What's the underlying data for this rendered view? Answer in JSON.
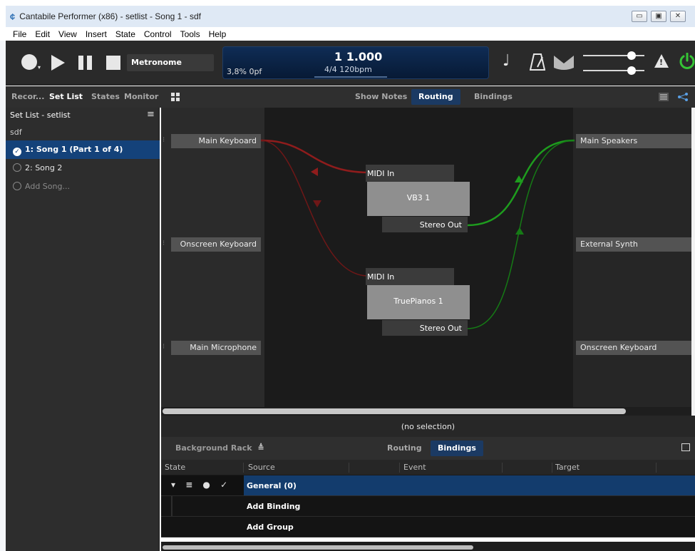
{
  "window": {
    "title": "Cantabile Performer (x86) - setlist - Song 1 - sdf",
    "app_icon": "¢",
    "controls": [
      "▭",
      "▣",
      "✕"
    ]
  },
  "menu": [
    "File",
    "Edit",
    "View",
    "Insert",
    "State",
    "Control",
    "Tools",
    "Help"
  ],
  "transport": {
    "metronome_label": "Metronome",
    "cpu": "3,8% 0pf",
    "position": "1 1.000",
    "tempo": "4/4 120bpm",
    "record_arrow": "▾"
  },
  "left_tabs": [
    {
      "label": "Recor...",
      "active": false
    },
    {
      "label": "Set List",
      "active": true
    },
    {
      "label": "States",
      "active": false
    },
    {
      "label": "Monitor",
      "active": false
    }
  ],
  "center_tabs": [
    {
      "label": "Show Notes",
      "active": false
    },
    {
      "label": "Routing",
      "active": true
    },
    {
      "label": "Bindings",
      "active": false
    }
  ],
  "setlist": {
    "header": "Set List - setlist",
    "name": "sdf",
    "songs": [
      {
        "label": "1: Song 1 (Part 1 of 4)",
        "active": true
      },
      {
        "label": "2: Song 2",
        "active": false
      },
      {
        "label": "Add Song...",
        "active": false
      }
    ]
  },
  "routing": {
    "inputs": [
      "Main Keyboard",
      "Onscreen Keyboard",
      "Main Microphone"
    ],
    "outputs": [
      "Main Speakers",
      "External Synth",
      "Onscreen Keyboard"
    ],
    "plugins": [
      {
        "name": "VB3 1",
        "in": "MIDI In",
        "out": "Stereo Out"
      },
      {
        "name": "TruePianos 1",
        "in": "MIDI In",
        "out": "Stereo Out"
      }
    ],
    "colors": {
      "midi": "#8f1c1c",
      "audio": "#1e9c1e"
    }
  },
  "status": "(no selection)",
  "bottom": {
    "rack_label": "Background Rack",
    "rack_icon": "≜",
    "tabs": [
      {
        "label": "Routing",
        "active": false
      },
      {
        "label": "Bindings",
        "active": true
      }
    ],
    "columns": [
      "State",
      "Source",
      "Event",
      "Target"
    ],
    "group_label": "General (0)",
    "row_icons": "▾ ≡ ● ✓",
    "add_binding": "Add Binding",
    "add_group": "Add Group"
  }
}
